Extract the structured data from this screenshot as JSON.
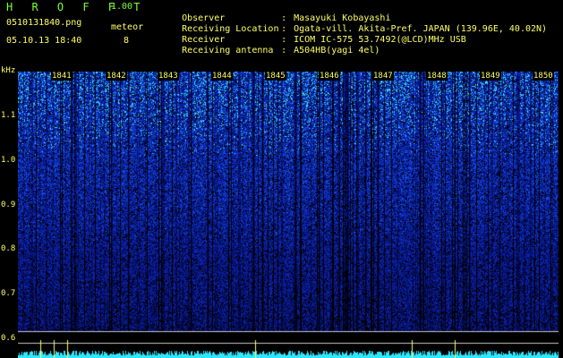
{
  "app": {
    "title": "H R O F F T",
    "version": "1.00"
  },
  "file": {
    "name": "0510131840.png",
    "datetime": "05.10.13 18:40"
  },
  "meteor": {
    "label": "meteor",
    "count": "8"
  },
  "info": [
    {
      "label": "Observer",
      "sep": ":",
      "value": "Masayuki Kobayashi"
    },
    {
      "label": "Receiving Location",
      "sep": ":",
      "value": "Ogata-vill. Akita-Pref. JAPAN (139.96E, 40.02N)"
    },
    {
      "label": "Receiver",
      "sep": ":",
      "value": "ICOM IC-575 53.7492(@LCD)MHz USB"
    },
    {
      "label": "Receiving antenna",
      "sep": ":",
      "value": "A504HB(yagi 4el)"
    }
  ],
  "spectrogram": {
    "y_unit": "kHz",
    "y_ticks": [
      "1.1",
      "1.0",
      "0.9",
      "0.8",
      "0.7",
      "0.6"
    ],
    "time_ticks": [
      "1841",
      "1842",
      "1843",
      "1844",
      "1845",
      "1846",
      "1847",
      "1848",
      "1849",
      "1850"
    ],
    "colors": {
      "background": "#000000",
      "noise": "#1230c0",
      "signal": "#39e6ff",
      "text": "#ffff66",
      "title": "#7cff3a"
    }
  }
}
